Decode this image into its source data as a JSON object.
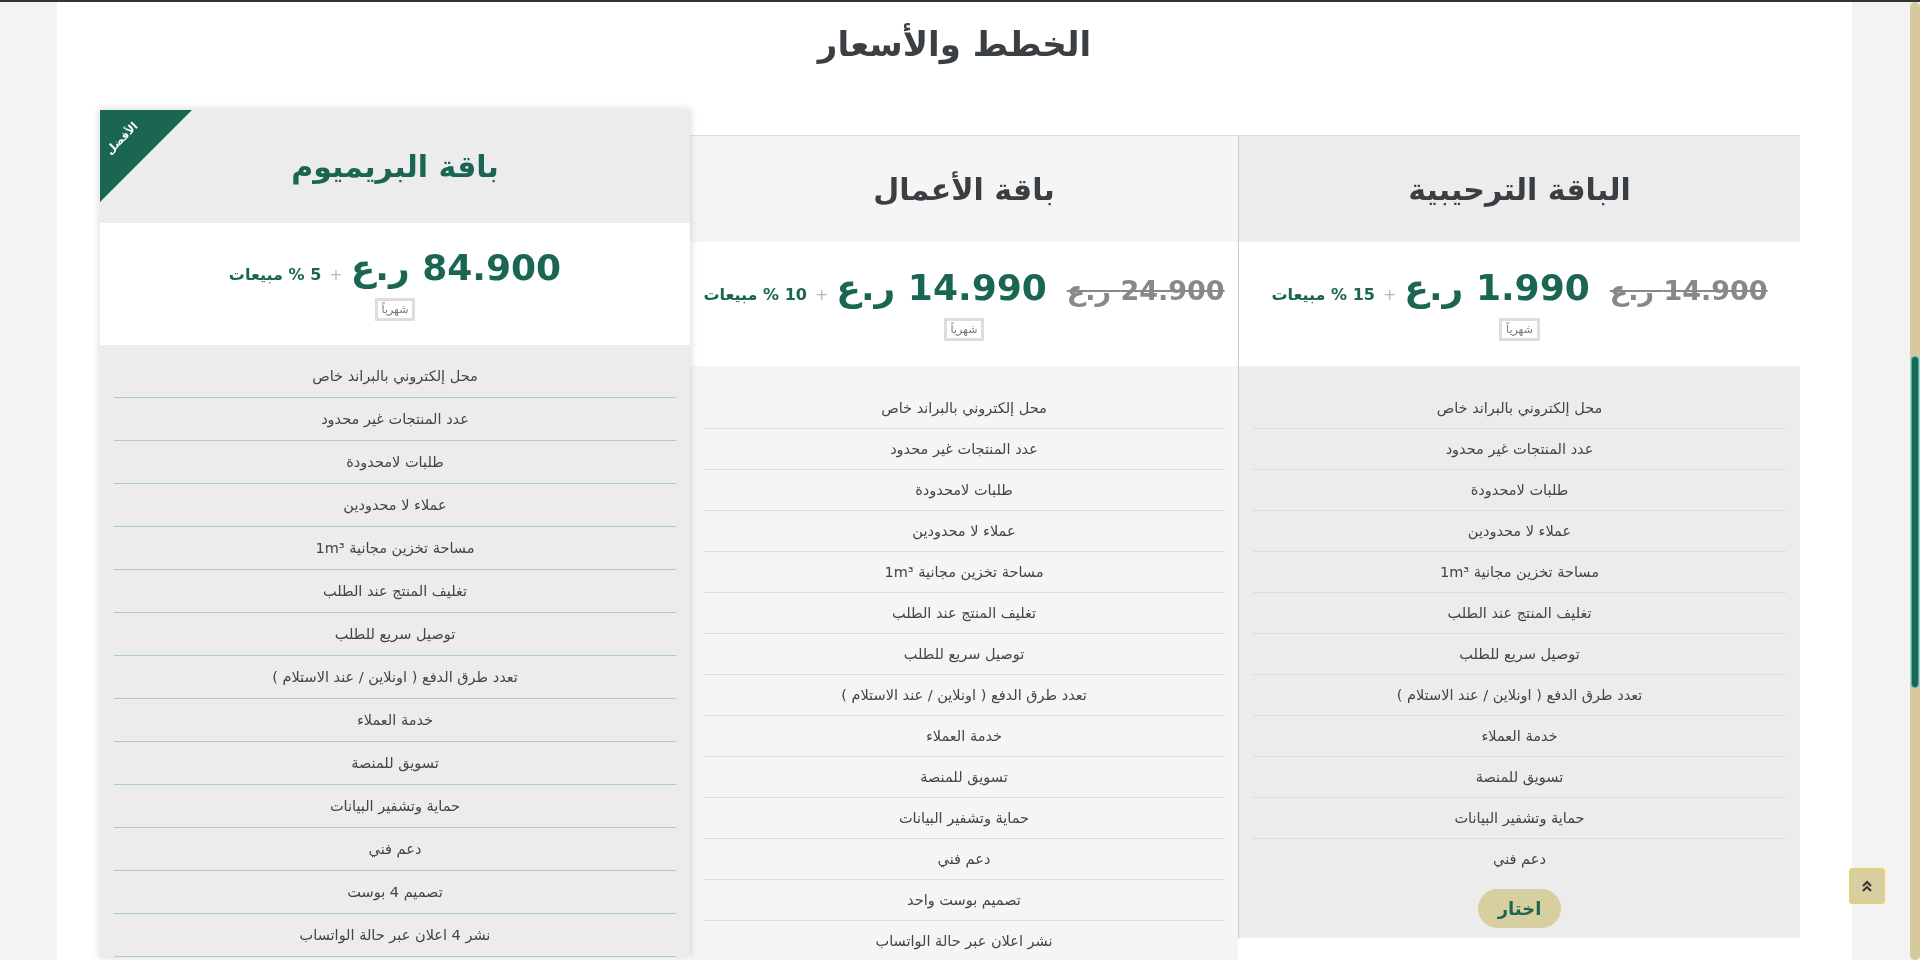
{
  "title": "الخطط والأسعار",
  "plans": [
    {
      "name": "الباقة الترحيبية",
      "featured": false,
      "old_price": "14.900",
      "old_currency": "ر.ع",
      "price": "1.990",
      "currency": "ر.ع",
      "plus": "+",
      "commission": "15 % مبيعات",
      "period": "شهرياً",
      "features": [
        "محل إلكتروني بالبراند خاص",
        "عدد المنتجات غير محدود",
        "طلبات لامحدودة",
        "عملاء لا محدودين",
        "مساحة تخزين مجانية 1m³",
        "تغليف المنتج عند الطلب",
        "توصيل سريع للطلب",
        "تعدد طرق الدفع ( اونلاين / عند الاستلام )",
        "خدمة العملاء",
        "تسويق للمنصة",
        "حماية وتشفير البيانات",
        "دعم فني"
      ],
      "button": "اختار"
    },
    {
      "name": "باقة الأعمال",
      "featured": false,
      "old_price": "24.900",
      "old_currency": "ر.ع",
      "price": "14.990",
      "currency": "ر.ع",
      "plus": "+",
      "commission": "10 % مبيعات",
      "period": "شهرياً",
      "features": [
        "محل إلكتروني بالبراند خاص",
        "عدد المنتجات غير محدود",
        "طلبات لامحدودة",
        "عملاء لا محدودين",
        "مساحة تخزين مجانية 1m³",
        "تغليف المنتج عند الطلب",
        "توصيل سريع للطلب",
        "تعدد طرق الدفع ( اونلاين / عند الاستلام )",
        "خدمة العملاء",
        "تسويق للمنصة",
        "حماية وتشفير البيانات",
        "دعم فني",
        "تصميم بوست واحد",
        "نشر اعلان عبر حالة الواتساب"
      ]
    },
    {
      "name": "باقة البريميوم",
      "featured": true,
      "badge": "الأفضل",
      "price": "84.900",
      "currency": "ر.ع",
      "plus": "+",
      "commission": "5 % مبيعات",
      "period": "شهرياً",
      "features": [
        "محل إلكتروني بالبراند خاص",
        "عدد المنتجات غير محدود",
        "طلبات لامحدودة",
        "عملاء لا محدودين",
        "مساحة تخزين مجانية 1m³",
        "تغليف المنتج عند الطلب",
        "توصيل سريع للطلب",
        "تعدد طرق الدفع ( اونلاين / عند الاستلام )",
        "خدمة العملاء",
        "تسويق للمنصة",
        "حماية وتشفير البيانات",
        "دعم فني",
        "تصميم 4 بوست",
        "نشر 4 اعلان عبر حالة الواتساب"
      ]
    }
  ]
}
